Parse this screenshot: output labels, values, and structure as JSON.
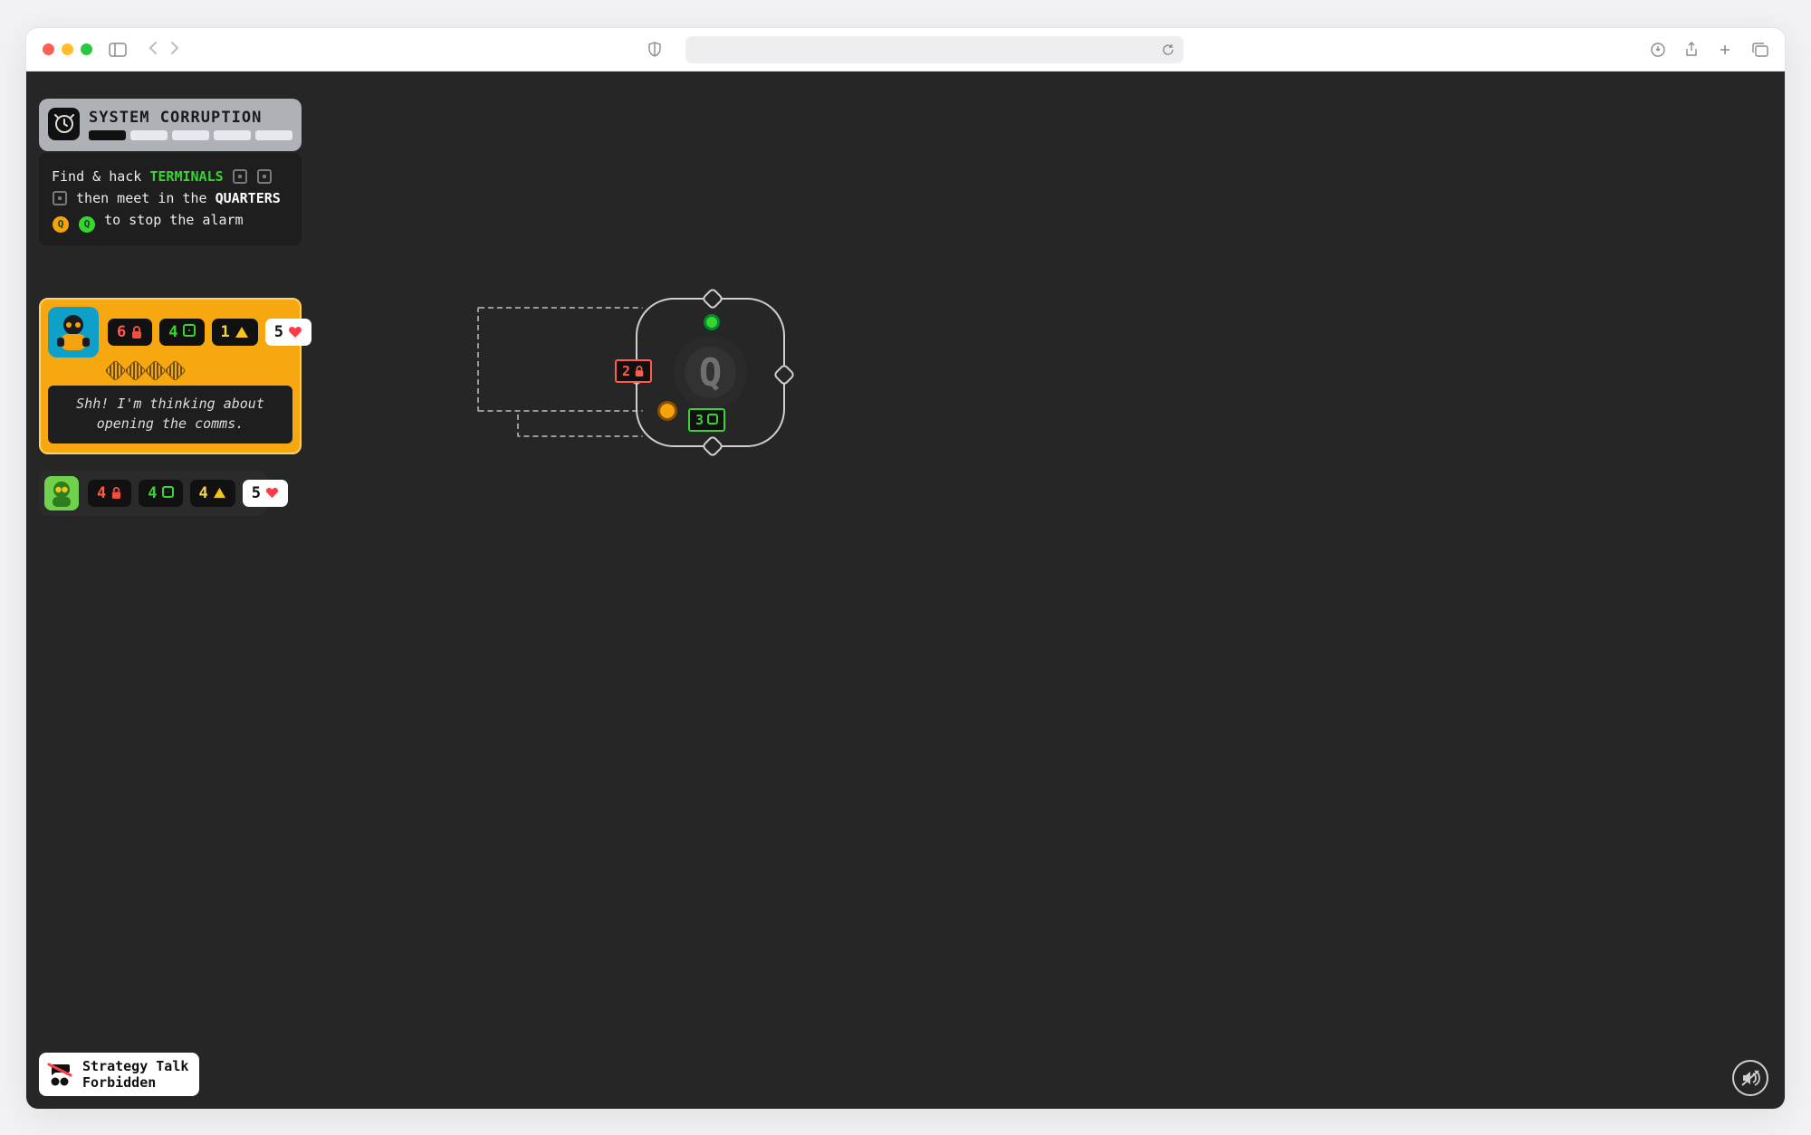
{
  "system": {
    "title": "SYSTEM CORRUPTION",
    "segments_total": 5,
    "segments_filled": 1
  },
  "mission": {
    "pre": "Find & hack ",
    "kw_terminals": "TERMINALS",
    "mid": " then meet in the ",
    "kw_quarters": "QUARTERS",
    "post": " to stop the alarm"
  },
  "players": {
    "active": {
      "color": "orange",
      "lock": 6,
      "cpu": 4,
      "risk": 1,
      "hp": 5,
      "card_slots": 4,
      "speech": "Shh! I'm thinking about opening the comms."
    },
    "other": {
      "color": "green",
      "lock": 4,
      "cpu": 4,
      "risk": 4,
      "hp": 5
    }
  },
  "board": {
    "room_letter": "Q",
    "door_lock": {
      "value": 2
    },
    "door_cpu": {
      "value": 3
    }
  },
  "strategy": {
    "line1": "Strategy Talk",
    "line2": "Forbidden"
  },
  "icons": {
    "lock": "lock-icon",
    "cpu": "cpu-icon",
    "risk": "warning-icon",
    "hp": "heart-icon"
  }
}
